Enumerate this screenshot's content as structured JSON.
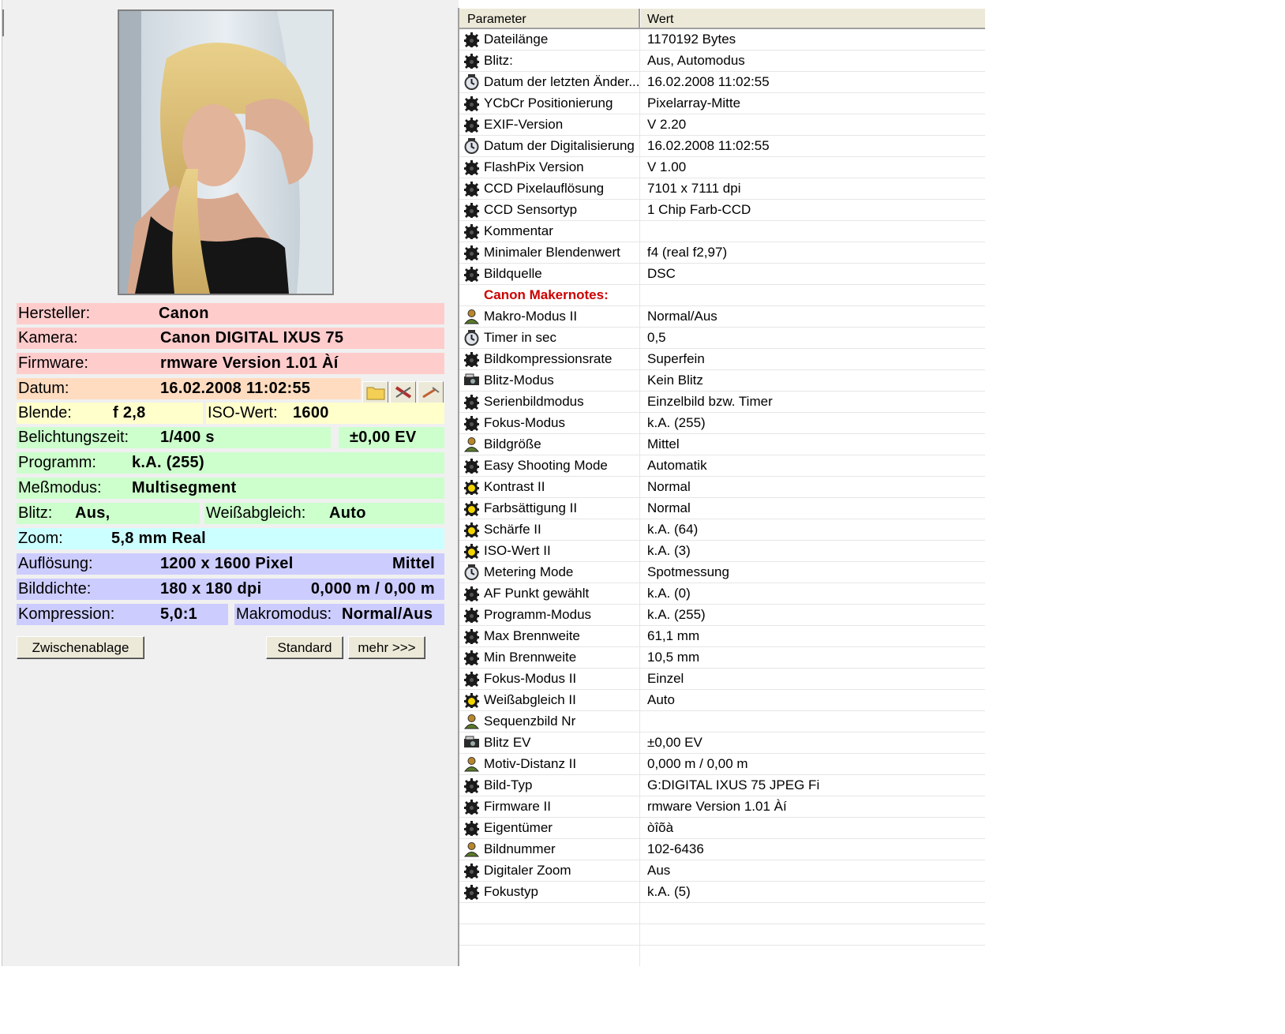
{
  "left": {
    "photo_alt": "",
    "fields": {
      "hersteller_label": "Hersteller:",
      "hersteller_value": "Canon",
      "kamera_label": "Kamera:",
      "kamera_value": "Canon DIGITAL IXUS 75",
      "firmware_label": "Firmware:",
      "firmware_value": "rmware Version 1.01   Àí",
      "datum_label": "Datum:",
      "datum_value": "16.02.2008 11:02:55",
      "blende_label": "Blende:",
      "blende_value": "f 2,8",
      "iso_label": "ISO-Wert:",
      "iso_value": "1600",
      "belichtung_label": "Belichtungszeit:",
      "belichtung_value": "1/400 s",
      "ev_value": "±0,00 EV",
      "programm_label": "Programm:",
      "programm_value": "k.A. (255)",
      "messmodus_label": "Meßmodus:",
      "messmodus_value": "Multisegment",
      "blitz_label": "Blitz:",
      "blitz_value": "Aus,",
      "weiss_label": "Weißabgleich:",
      "weiss_value": "Auto",
      "zoom_label": "Zoom:",
      "zoom_value": "5,8 mm Real",
      "aufloesung_label": "Auflösung:",
      "aufloesung_value": "1200 x 1600 Pixel",
      "aufloesung_size": "Mittel",
      "bilddichte_label": "Bilddichte:",
      "bilddichte_value": "180 x 180 dpi",
      "bilddichte_distance": "0,000 m / 0,00 m",
      "kompression_label": "Kompression:",
      "kompression_value": "5,0:1",
      "makro_label": "Makromodus:",
      "makro_value": "Normal/Aus"
    },
    "toolbar_icons": [
      "folder-icon",
      "stamp-icon",
      "edit-icon"
    ],
    "buttons": {
      "clipboard": "Zwischenablage",
      "standard": "Standard",
      "more": "mehr >>>"
    }
  },
  "table": {
    "col_param": "Parameter",
    "col_value": "Wert",
    "rows": [
      {
        "icon": "gear-black",
        "param": "Dateilänge",
        "value": "1170192 Bytes"
      },
      {
        "icon": "gear-black",
        "param": "Blitz:",
        "value": "Aus, Automodus"
      },
      {
        "icon": "clock",
        "param": "Datum der letzten Änder...",
        "value": "16.02.2008 11:02:55"
      },
      {
        "icon": "gear-black",
        "param": "YCbCr Positionierung",
        "value": "Pixelarray-Mitte"
      },
      {
        "icon": "gear-black",
        "param": "EXIF-Version",
        "value": "V 2.20"
      },
      {
        "icon": "clock",
        "param": "Datum der Digitalisierung",
        "value": "16.02.2008 11:02:55"
      },
      {
        "icon": "gear-black",
        "param": "FlashPix Version",
        "value": "V 1.00"
      },
      {
        "icon": "gear-black",
        "param": "CCD Pixelauflösung",
        "value": "7101 x 7111 dpi"
      },
      {
        "icon": "gear-black",
        "param": "CCD Sensortyp",
        "value": "1 Chip Farb-CCD"
      },
      {
        "icon": "gear-black",
        "param": "Kommentar",
        "value": ""
      },
      {
        "icon": "gear-black",
        "param": "Minimaler Blendenwert",
        "value": "f4 (real f2,97)"
      },
      {
        "icon": "gear-black",
        "param": "Bildquelle",
        "value": "DSC"
      },
      {
        "icon": "none",
        "param": "Canon Makernotes:",
        "value": "",
        "section": true
      },
      {
        "icon": "person",
        "param": "Makro-Modus II",
        "value": "Normal/Aus"
      },
      {
        "icon": "clock",
        "param": "Timer in sec",
        "value": "0,5"
      },
      {
        "icon": "gear-black",
        "param": "Bildkompressionsrate",
        "value": "Superfein"
      },
      {
        "icon": "flash",
        "param": "Blitz-Modus",
        "value": "Kein Blitz"
      },
      {
        "icon": "gear-black",
        "param": "Serienbildmodus",
        "value": "Einzelbild bzw. Timer"
      },
      {
        "icon": "gear-black",
        "param": "Fokus-Modus",
        "value": "k.A. (255)"
      },
      {
        "icon": "person",
        "param": "Bildgröße",
        "value": "Mittel"
      },
      {
        "icon": "gear-black",
        "param": "Easy Shooting Mode",
        "value": "Automatik"
      },
      {
        "icon": "gear-yellow",
        "param": "Kontrast II",
        "value": "Normal"
      },
      {
        "icon": "gear-yellow",
        "param": "Farbsättigung II",
        "value": "Normal"
      },
      {
        "icon": "gear-yellow",
        "param": "Schärfe II",
        "value": "k.A. (64)"
      },
      {
        "icon": "gear-yellow",
        "param": "ISO-Wert II",
        "value": "k.A. (3)"
      },
      {
        "icon": "clock",
        "param": "Metering Mode",
        "value": "Spotmessung"
      },
      {
        "icon": "gear-black",
        "param": "AF Punkt gewählt",
        "value": "k.A. (0)"
      },
      {
        "icon": "gear-black",
        "param": "Programm-Modus",
        "value": "k.A. (255)"
      },
      {
        "icon": "gear-black",
        "param": "Max Brennweite",
        "value": "61,1 mm"
      },
      {
        "icon": "gear-black",
        "param": "Min Brennweite",
        "value": "10,5 mm"
      },
      {
        "icon": "gear-black",
        "param": "Fokus-Modus II",
        "value": "Einzel"
      },
      {
        "icon": "gear-yellow",
        "param": "Weißabgleich II",
        "value": "Auto"
      },
      {
        "icon": "person",
        "param": "Sequenzbild Nr",
        "value": ""
      },
      {
        "icon": "flash",
        "param": "Blitz EV",
        "value": "±0,00 EV"
      },
      {
        "icon": "person",
        "param": "Motiv-Distanz II",
        "value": "0,000 m / 0,00 m"
      },
      {
        "icon": "gear-black",
        "param": "Bild-Typ",
        "value": "G:DIGITAL IXUS 75 JPEG        Fi"
      },
      {
        "icon": "gear-black",
        "param": "Firmware II",
        "value": "rmware Version 1.01   Àí"
      },
      {
        "icon": "gear-black",
        "param": "Eigentümer",
        "value": "òîõà"
      },
      {
        "icon": "person",
        "param": "Bildnummer",
        "value": "102-6436"
      },
      {
        "icon": "gear-black",
        "param": "Digitaler Zoom",
        "value": "Aus"
      },
      {
        "icon": "gear-black",
        "param": "Fokustyp",
        "value": "k.A. (5)"
      },
      {
        "icon": "none",
        "param": "",
        "value": ""
      },
      {
        "icon": "none",
        "param": "",
        "value": ""
      },
      {
        "icon": "none",
        "param": "",
        "value": ""
      },
      {
        "icon": "none",
        "param": "",
        "value": ""
      }
    ]
  }
}
